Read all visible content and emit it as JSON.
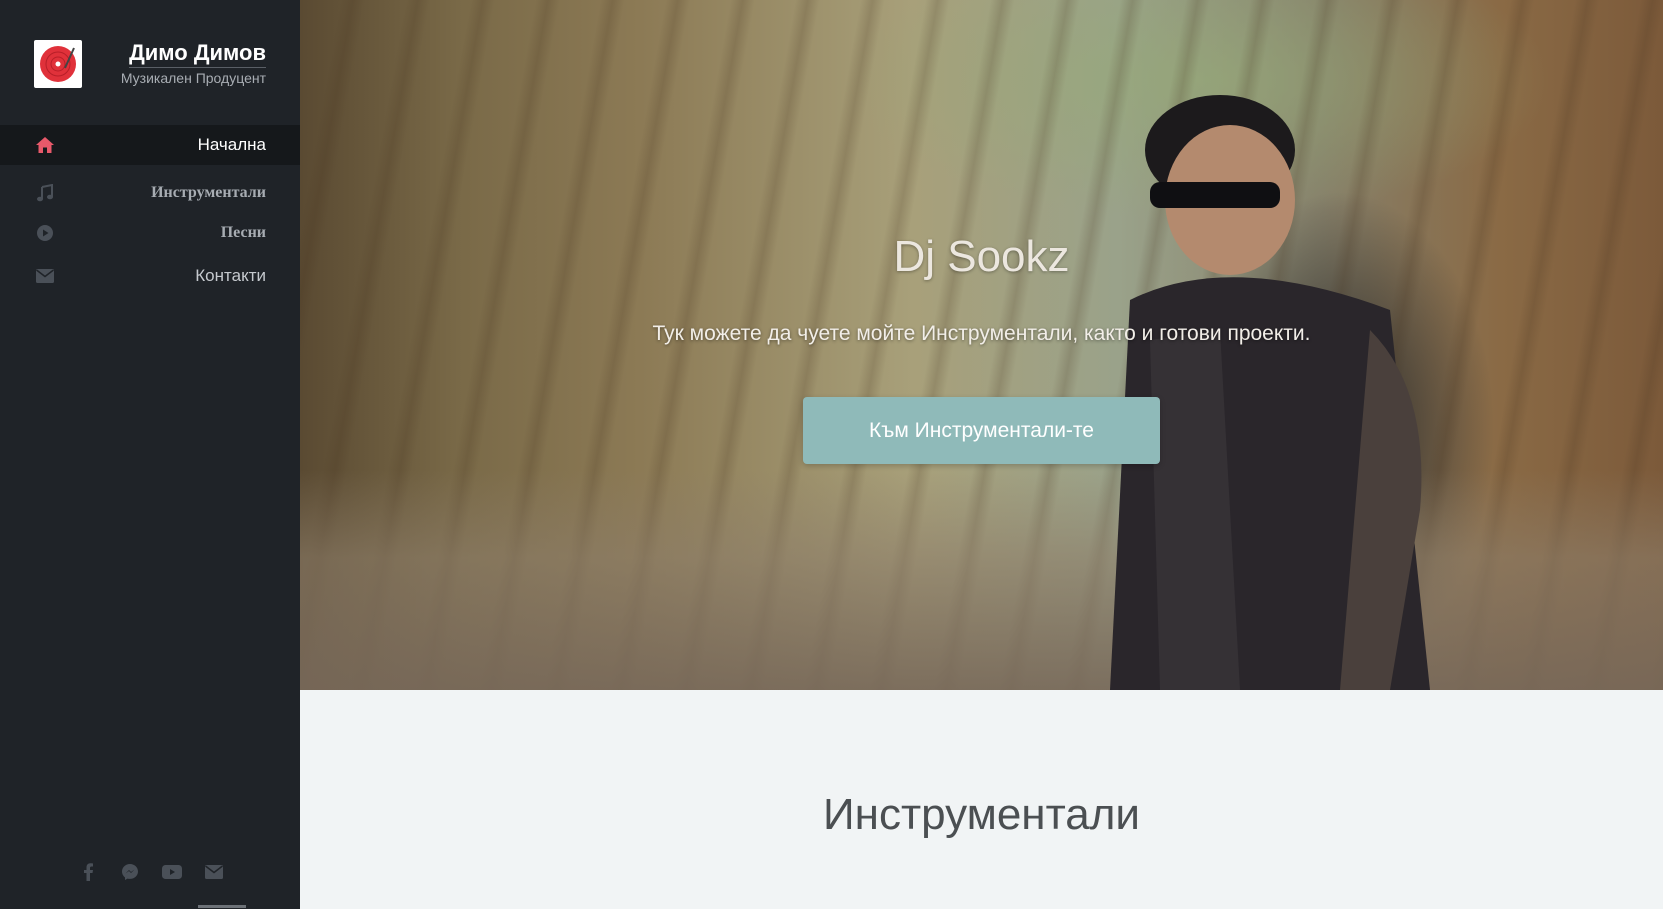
{
  "brand": {
    "title": "Димо Димов",
    "subtitle": "Музикален Продуцент",
    "logo_icon": "vinyl-record-icon",
    "logo_color": "#e0313a"
  },
  "nav": {
    "items": [
      {
        "label": "Начална",
        "icon": "home-icon",
        "active": true
      },
      {
        "label": "Инструментали",
        "icon": "music-note-icon",
        "active": false
      },
      {
        "label": "Песни",
        "icon": "play-circle-icon",
        "active": false
      },
      {
        "label": "Контакти",
        "icon": "envelope-icon",
        "active": false
      }
    ],
    "active_icon_color": "#e8596a"
  },
  "socials": [
    {
      "icon": "facebook-icon"
    },
    {
      "icon": "messenger-icon"
    },
    {
      "icon": "youtube-icon"
    },
    {
      "icon": "envelope-icon"
    }
  ],
  "hero": {
    "title": "Dj Sookz",
    "subtitle": "Тук можете да чуете мойте Инструментали, както и готови проекти.",
    "button_label": "Към Инструментали-те",
    "button_color": "#8fbab9"
  },
  "section": {
    "title": "Инструментали"
  }
}
